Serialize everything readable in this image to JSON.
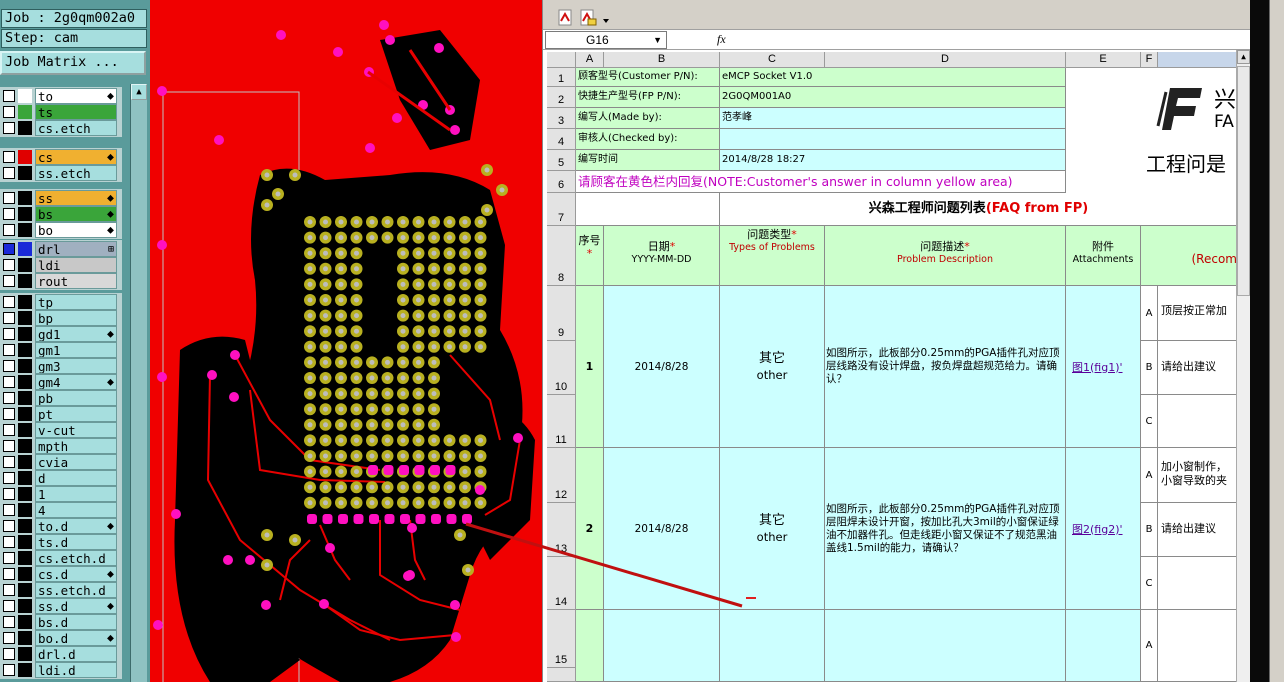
{
  "genesis": {
    "job_label": "Job : 2g0qm002a0",
    "step_label": "Step: cam",
    "matrix_button": "Job Matrix ...",
    "groups": [
      {
        "layers": [
          {
            "name": "to",
            "color": "#ffffff",
            "mark": "⬥"
          },
          {
            "name": "ts",
            "color": "#3aa53a",
            "mark": ""
          },
          {
            "name": "cs.etch",
            "color": "#000000",
            "mark": ""
          }
        ]
      },
      {
        "layers": [
          {
            "name": "cs",
            "color": "#e00000",
            "mark": "⬥"
          },
          {
            "name": "ss.etch",
            "color": "#000000",
            "mark": ""
          }
        ]
      },
      {
        "layers": [
          {
            "name": "ss",
            "color": "#000000",
            "mark": "⬥"
          },
          {
            "name": "bs",
            "color": "#000000",
            "mark": "⬥"
          },
          {
            "name": "bo",
            "color": "#000000",
            "mark": "⬥"
          }
        ]
      },
      {
        "layers": [
          {
            "name": "drl",
            "color": "#1a2ad8",
            "mark": "⊞"
          },
          {
            "name": "ldi",
            "color": "#000000",
            "mark": ""
          },
          {
            "name": "rout",
            "color": "#000000",
            "mark": ""
          }
        ]
      },
      {
        "layers": [
          {
            "name": "tp",
            "color": "#000000",
            "mark": ""
          },
          {
            "name": "bp",
            "color": "#000000",
            "mark": ""
          },
          {
            "name": "gd1",
            "color": "#000000",
            "mark": "⬥"
          },
          {
            "name": "gm1",
            "color": "#000000",
            "mark": ""
          },
          {
            "name": "gm3",
            "color": "#000000",
            "mark": ""
          },
          {
            "name": "gm4",
            "color": "#000000",
            "mark": "⬥"
          },
          {
            "name": "pb",
            "color": "#000000",
            "mark": ""
          },
          {
            "name": "pt",
            "color": "#000000",
            "mark": ""
          },
          {
            "name": "v-cut",
            "color": "#000000",
            "mark": ""
          },
          {
            "name": "mpth",
            "color": "#000000",
            "mark": ""
          },
          {
            "name": "cvia",
            "color": "#000000",
            "mark": ""
          },
          {
            "name": "d",
            "color": "#000000",
            "mark": ""
          },
          {
            "name": "1",
            "color": "#000000",
            "mark": ""
          },
          {
            "name": "4",
            "color": "#000000",
            "mark": ""
          },
          {
            "name": "to.d",
            "color": "#000000",
            "mark": "⬥"
          },
          {
            "name": "ts.d",
            "color": "#000000",
            "mark": ""
          },
          {
            "name": "cs.etch.d",
            "color": "#000000",
            "mark": ""
          },
          {
            "name": "cs.d",
            "color": "#000000",
            "mark": "⬥"
          },
          {
            "name": "ss.etch.d",
            "color": "#000000",
            "mark": ""
          },
          {
            "name": "ss.d",
            "color": "#000000",
            "mark": "⬥"
          },
          {
            "name": "bs.d",
            "color": "#000000",
            "mark": ""
          },
          {
            "name": "bo.d",
            "color": "#000000",
            "mark": "⬥"
          },
          {
            "name": "drl.d",
            "color": "#000000",
            "mark": ""
          },
          {
            "name": "ldi.d",
            "color": "#000000",
            "mark": ""
          }
        ]
      }
    ],
    "layer_bg_colors": {
      "ts": "#3aa53a",
      "cs": "#f0b030",
      "ss": "#f0b030",
      "bs": "#3aa53a",
      "bo": "#ffffff",
      "drl": "#a0b0c0",
      "ldi": "#c8c8c8",
      "rout": "#d8d8d8",
      "to": "#ffffff"
    }
  },
  "excel": {
    "name_box": "G16",
    "fx_label": "fx",
    "columns": [
      "A",
      "B",
      "C",
      "D",
      "E",
      "F"
    ],
    "rows": {
      "r1": {
        "num": "1",
        "label": "顾客型号(Customer P/N):",
        "value": "eMCP Socket V1.0"
      },
      "r2": {
        "num": "2",
        "label": "快捷生产型号(FP P/N):",
        "value": "2G0QM001A0"
      },
      "r3": {
        "num": "3",
        "label": "编写人(Made by):",
        "value": "范孝峰"
      },
      "r4": {
        "num": "4",
        "label": "审核人(Checked by):",
        "value": ""
      },
      "r5": {
        "num": "5",
        "label": "编写时间",
        "value": "2014/8/28 18:27"
      },
      "r6": {
        "num": "6",
        "text": "请顾客在黄色栏内回复(NOTE:Customer's answer in column yellow area)"
      },
      "r7": {
        "num": "7",
        "title": "兴森工程师问题列表",
        "title_en": "(FAQ from FP)"
      }
    },
    "logo_text": "兴",
    "logo_sub": "FA",
    "doc_title": "工程问是",
    "header": {
      "num": "8",
      "seq_cn": "序号",
      "date_cn": "日期",
      "date_fmt": "YYYY-MM-DD",
      "type_cn": "问题类型",
      "type_en": "Types of Problems",
      "desc_cn": "问题描述",
      "desc_en": "Problem Description",
      "att_cn": "附件",
      "att_en": "Attachments",
      "rec_en": "(Recom"
    },
    "row_nums": [
      "9",
      "10",
      "11",
      "12",
      "13",
      "14",
      "15"
    ],
    "items": [
      {
        "seq": "1",
        "date": "2014/8/28",
        "type_cn": "其它",
        "type_en": "other",
        "desc": "如图所示，此板部分0.25mm的PGA插件孔对应顶层线路没有设计焊盘，按负焊盘超规范给力。请确认？",
        "attachment": "图1(fig1)'",
        "options": [
          {
            "label": "A",
            "text": "顶层按正常加"
          },
          {
            "label": "B",
            "text": "请给出建议"
          },
          {
            "label": "C",
            "text": ""
          }
        ]
      },
      {
        "seq": "2",
        "date": "2014/8/28",
        "type_cn": "其它",
        "type_en": "other",
        "desc": "如图所示，此板部分0.25mm的PGA插件孔对应顶层阻焊未设计开窗，按加比孔大3mil的小窗保证绿油不加器件孔。但走线距小窗又保证不了规范黑油盖线1.5mil的能力，请确认？",
        "attachment": "图2(fig2)'",
        "options": [
          {
            "label": "A",
            "text": "加小窗制作，小窗导致的夹"
          },
          {
            "label": "B",
            "text": "请给出建议"
          },
          {
            "label": "C",
            "text": ""
          }
        ]
      },
      {
        "seq": "",
        "date": "",
        "type_cn": "",
        "type_en": "",
        "desc": "",
        "attachment": "",
        "options": [
          {
            "label": "A",
            "text": ""
          }
        ]
      }
    ]
  },
  "colors": {
    "canvas_bg": "#f00000",
    "board": "#000000",
    "pad": "#b8b020",
    "via": "#ff10c0",
    "excel_green": "#ccffcc",
    "excel_cyan": "#ccffff"
  }
}
